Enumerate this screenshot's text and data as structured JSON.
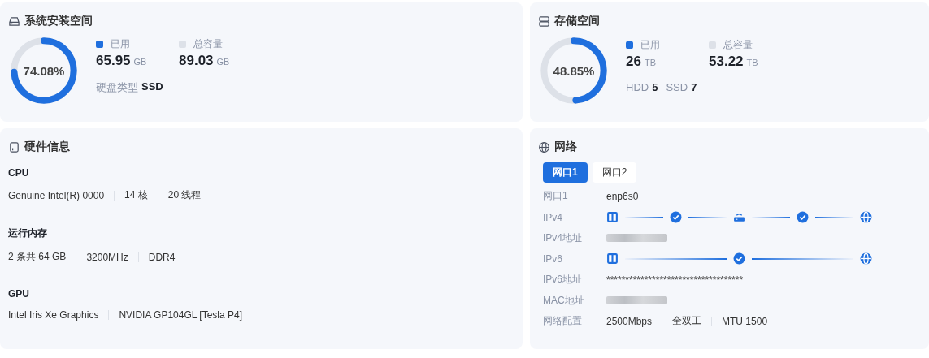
{
  "system_disk": {
    "title": "系统安装空间",
    "usage": {
      "level": 0.7408,
      "percent": "74.08%"
    },
    "used": {
      "legend": "已用",
      "value": "65.95",
      "unit": "GB"
    },
    "total": {
      "legend": "总容量",
      "value": "89.03",
      "unit": "GB"
    },
    "extras": [
      {
        "label": "硬盘类型",
        "value": "SSD"
      }
    ]
  },
  "storage": {
    "title": "存储空间",
    "usage": {
      "level": 0.4885,
      "percent": "48.85%"
    },
    "used": {
      "legend": "已用",
      "value": "26",
      "unit": "TB"
    },
    "total": {
      "legend": "总容量",
      "value": "53.22",
      "unit": "TB"
    },
    "extras": [
      {
        "label": "HDD",
        "value": "5"
      },
      {
        "label": "SSD",
        "value": "7"
      }
    ]
  },
  "hardware": {
    "title": "硬件信息",
    "sections": [
      {
        "heading": "CPU",
        "items": [
          "Genuine Intel(R) 0000",
          "14 核",
          "20 线程"
        ]
      },
      {
        "heading": "运行内存",
        "items": [
          "2 条共 64 GB",
          "3200MHz",
          "DDR4"
        ]
      },
      {
        "heading": "GPU",
        "items": [
          "Intel Iris Xe Graphics",
          "NVIDIA GP104GL [Tesla P4]"
        ]
      }
    ]
  },
  "network": {
    "title": "网络",
    "tabs": [
      {
        "label": "网口1",
        "selected": true
      },
      {
        "label": "网口2",
        "selected": false
      }
    ],
    "rows": [
      {
        "label": "网口1",
        "kind": "text",
        "value": "enp6s0"
      },
      {
        "label": "IPv4",
        "kind": "path",
        "nodes": [
          {
            "kind": "port"
          },
          {
            "kind": "check"
          },
          {
            "kind": "router"
          },
          {
            "kind": "check"
          },
          {
            "kind": "globe"
          }
        ]
      },
      {
        "label": "IPv4地址",
        "kind": "redacted"
      },
      {
        "label": "IPv6",
        "kind": "path",
        "nodes": [
          {
            "kind": "port"
          },
          {
            "kind": "check"
          },
          {
            "kind": "globe"
          }
        ]
      },
      {
        "label": "IPv6地址",
        "kind": "text",
        "value": "************************************"
      },
      {
        "label": "MAC地址",
        "kind": "redacted"
      },
      {
        "label": "网络配置",
        "kind": "list",
        "items": [
          "2500Mbps",
          "全双工",
          "MTU 1500"
        ]
      }
    ]
  }
}
